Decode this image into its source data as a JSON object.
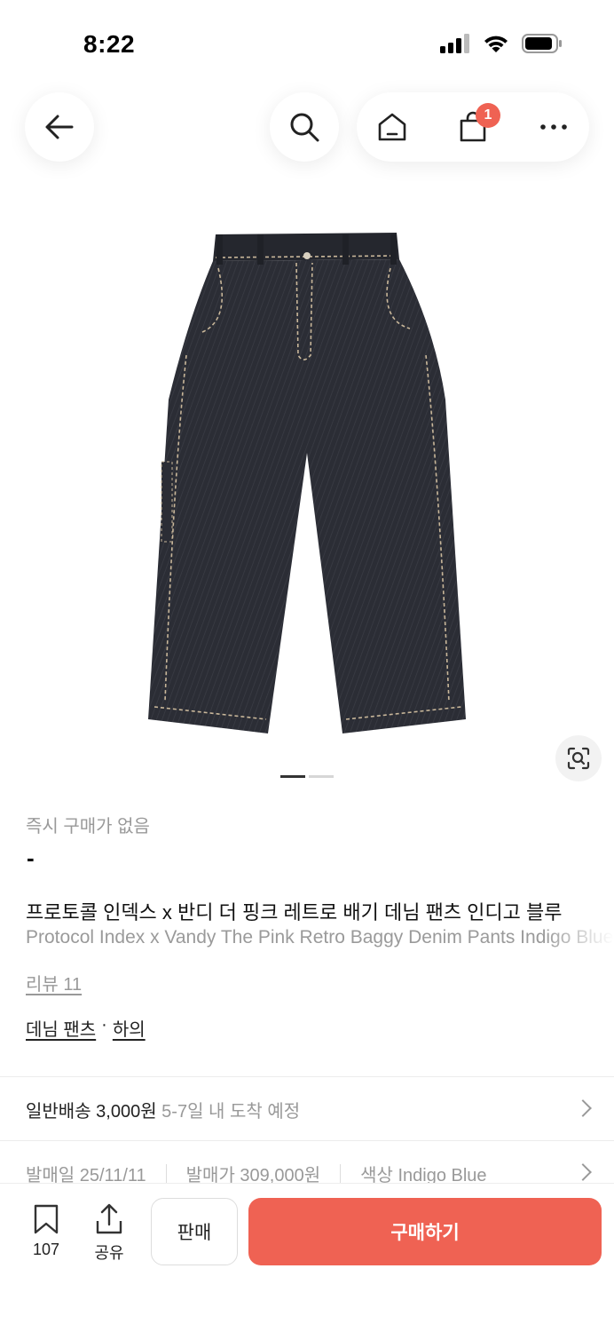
{
  "status": {
    "time": "8:22"
  },
  "header": {
    "cart_count": "1"
  },
  "product": {
    "instant_buy_text": "즉시 구매가 없음",
    "price": "-",
    "title_ko": "프로토콜 인덱스 x 반디 더 핑크 레트로 배기 데님 팬츠 인디고 블루",
    "title_en": "Protocol Index x Vandy The Pink Retro Baggy Denim Pants Indigo Blue",
    "review_label": "리뷰 11",
    "category_1": "데님 팬츠",
    "category_sep": "·",
    "category_2": "하의",
    "image_count": 2,
    "image_index": 1
  },
  "shipping": {
    "label": "일반배송 3,000원",
    "eta": "5-7일 내 도착 예정"
  },
  "specs": {
    "release_date": "발매일 25/11/11",
    "release_price": "발매가 309,000원",
    "color": "색상 Indigo Blue"
  },
  "bottom_bar": {
    "bookmark_count": "107",
    "share_label": "공유",
    "sell_label": "판매",
    "buy_label": "구매하기"
  },
  "colors": {
    "accent": "#ef6253",
    "denim": "#2a2c34",
    "stitch": "#c9b79a"
  }
}
